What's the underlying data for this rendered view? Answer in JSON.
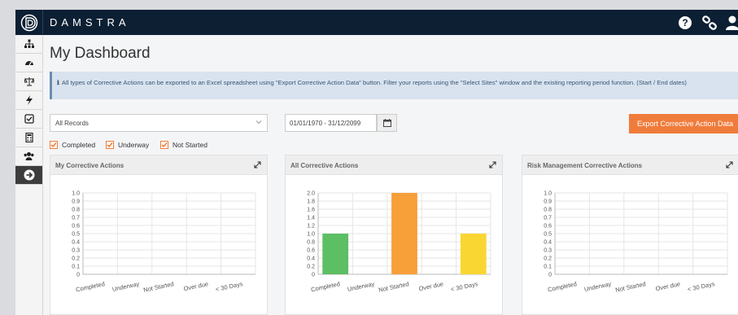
{
  "header": {
    "brand": "DAMSTRA"
  },
  "icons": {
    "logo": "damstra-logo-icon",
    "help": "question-circle-icon",
    "link": "link-icon",
    "user": "user-icon",
    "sidebar": [
      "sitemap-icon",
      "dashboard-gauge-icon",
      "balance-scale-icon",
      "bolt-icon",
      "check-square-icon",
      "calculator-icon",
      "users-icon",
      "arrow-circle-right-icon"
    ]
  },
  "main": {
    "title": "My Dashboard",
    "info": "All types of Corrective Actions can be exported to an Excel spreadsheet using \"Export Corrective Action Data\" button. Filter your reports using the \"Select Sites\" window and the existing reporting period function. (Start / End dates)"
  },
  "filters": {
    "records_value": "All Records",
    "date_range": "01/01/1970 - 31/12/2099",
    "export_label": "Export Corrective Action Data",
    "checks": [
      {
        "label": "Completed",
        "checked": true
      },
      {
        "label": "Underway",
        "checked": true
      },
      {
        "label": "Not Started",
        "checked": true
      }
    ]
  },
  "colors": {
    "accent": "#f07c3c",
    "header_bg": "#0c1f33",
    "bar_completed": "#5cbf63",
    "bar_not_started": "#f7a03a",
    "bar_30days": "#fad633"
  },
  "panels": [
    {
      "title": "My Corrective Actions"
    },
    {
      "title": "All Corrective Actions"
    },
    {
      "title": "Risk Management Corrective Actions"
    }
  ],
  "chart_data": [
    {
      "type": "bar",
      "title": "My Corrective Actions",
      "categories": [
        "Completed",
        "Underway",
        "Not Started",
        "Over due",
        "< 30 Days"
      ],
      "values": [
        0,
        0,
        0,
        0,
        0
      ],
      "ylim": [
        0,
        1.0
      ],
      "yticks": [
        "1.0",
        "0.9",
        "0.8",
        "0.7",
        "0.6",
        "0.5",
        "0.4",
        "0.3",
        "0.2",
        "0.1",
        "0"
      ],
      "grid": true
    },
    {
      "type": "bar",
      "title": "All Corrective Actions",
      "categories": [
        "Completed",
        "Underway",
        "Not Started",
        "Over due",
        "< 30 Days"
      ],
      "values": [
        1,
        0,
        2,
        0,
        1
      ],
      "bar_colors": [
        "#5cbf63",
        "#5cbf63",
        "#f7a03a",
        "#f7a03a",
        "#fad633"
      ],
      "ylim": [
        0,
        2.0
      ],
      "yticks": [
        "2.0",
        "1.8",
        "1.6",
        "1.4",
        "1.2",
        "1.0",
        "0.8",
        "0.6",
        "0.4",
        "0.2",
        "0"
      ],
      "grid": true
    },
    {
      "type": "bar",
      "title": "Risk Management Corrective Actions",
      "categories": [
        "Completed",
        "Underway",
        "Not Started",
        "Over due",
        "< 30 Days"
      ],
      "values": [
        0,
        0,
        0,
        0,
        0
      ],
      "ylim": [
        0,
        1.0
      ],
      "yticks": [
        "1.0",
        "0.9",
        "0.8",
        "0.7",
        "0.6",
        "0.5",
        "0.4",
        "0.3",
        "0.2",
        "0.1",
        "0"
      ],
      "grid": true
    }
  ]
}
